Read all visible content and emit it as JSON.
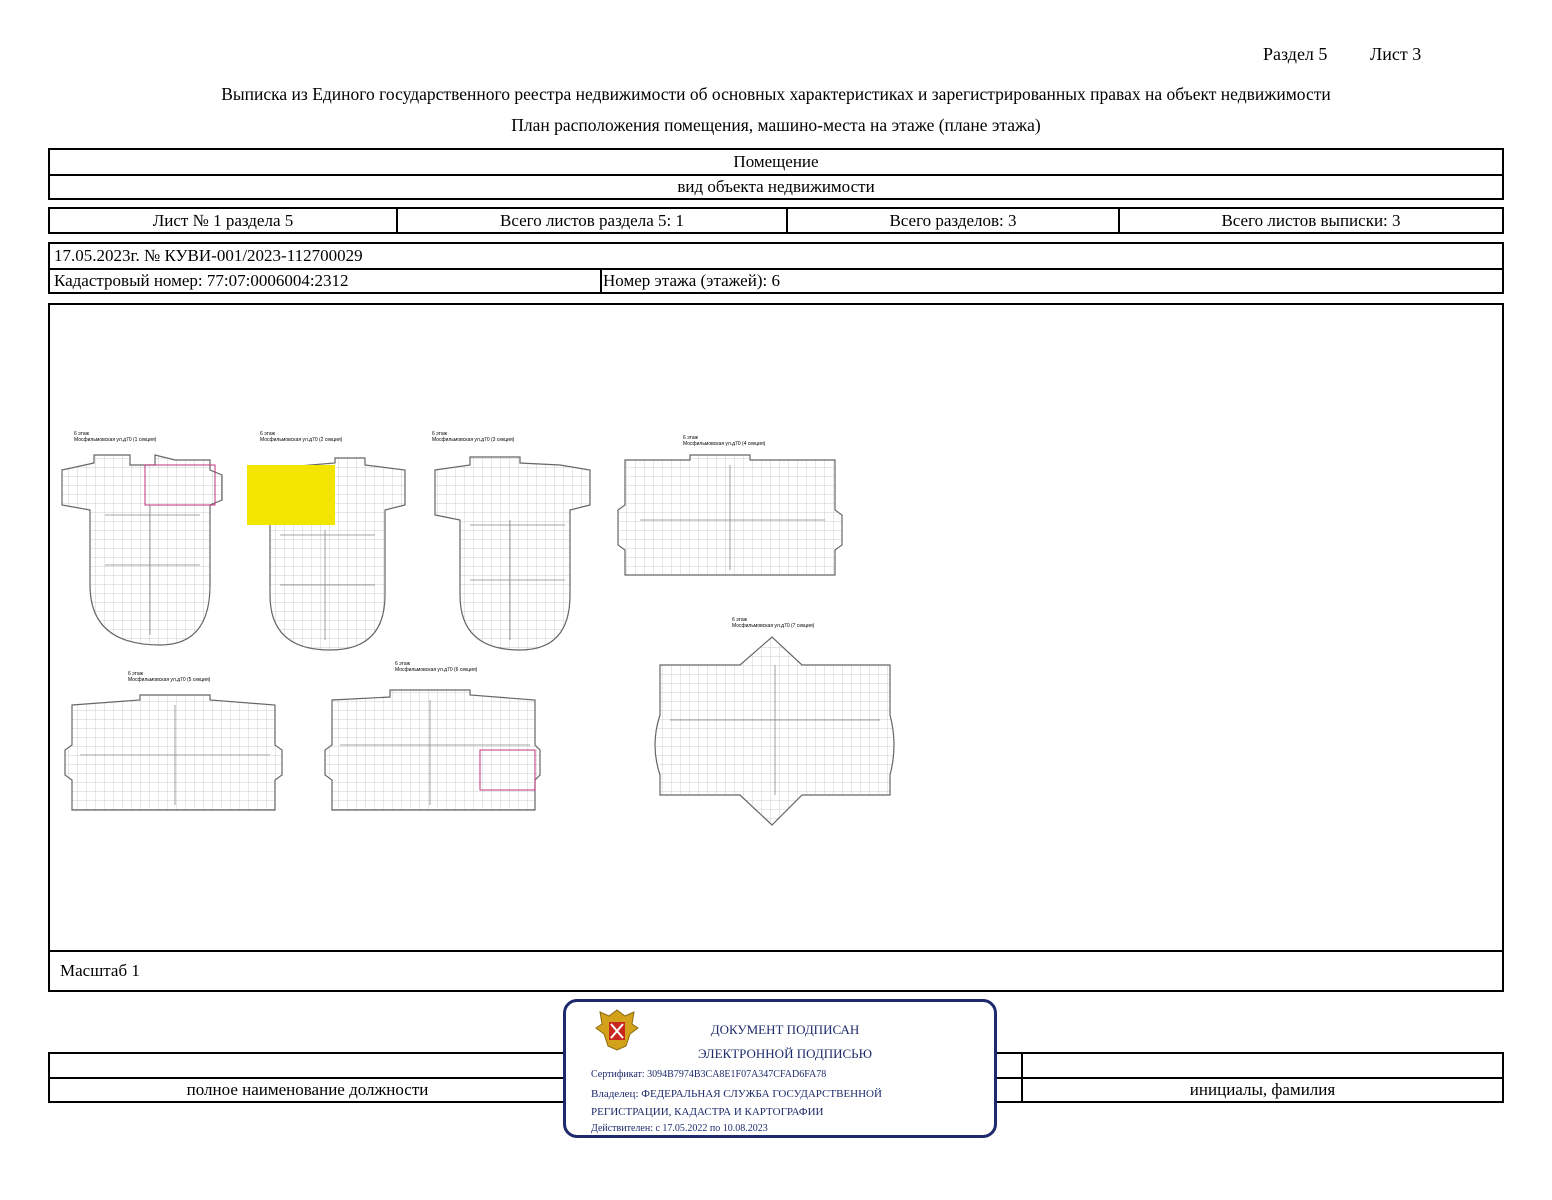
{
  "header": {
    "section": "Раздел 5",
    "sheet": "Лист 3",
    "title": "Выписка из Единого государственного реестра недвижимости об основных характеристиках и зарегистрированных правах на объект недвижимости",
    "subtitle": "План расположения помещения, машино-места на этаже (плане этажа)"
  },
  "object": {
    "type": "Помещение",
    "type_caption": "вид объекта недвижимости"
  },
  "sheets": {
    "sheet_no": "Лист № 1 раздела 5",
    "total_section_sheets": "Всего листов раздела 5: 1",
    "total_sections": "Всего разделов: 3",
    "total_extract_sheets": "Всего листов выписки: 3"
  },
  "record": {
    "date_number": "17.05.2023г. № КУВИ-001/2023-112700029",
    "cadastral": "Кадастровый номер: 77:07:0006004:2312",
    "floor": "Номер этажа (этажей): 6"
  },
  "plans": [
    {
      "floor": "6 этаж",
      "address": "Мосфильмовская ул.д70 (1 секция)"
    },
    {
      "floor": "6 этаж",
      "address": "Мосфильмовская ул.д70 (2 секция)"
    },
    {
      "floor": "6 этаж",
      "address": "Мосфильмовская ул.д70 (3 секция)"
    },
    {
      "floor": "6 этаж",
      "address": "Мосфильмовская ул.д70 (4 секция)"
    },
    {
      "floor": "6 этаж",
      "address": "Мосфильмовская ул.д70 (5 секция)"
    },
    {
      "floor": "6 этаж",
      "address": "Мосфильмовская ул.д70 (6 секция)"
    },
    {
      "floor": "6 этаж",
      "address": "Мосфильмовская ул.д70 (7 секция)"
    }
  ],
  "scale": "Масштаб 1",
  "footer": {
    "position_caption": "полное наименование должности",
    "name_caption": "инициалы, фамилия"
  },
  "stamp": {
    "line1": "ДОКУМЕНТ ПОДПИСАН",
    "line2": "ЭЛЕКТРОННОЙ ПОДПИСЬЮ",
    "certificate": "Сертификат: 3094B7974B3CA8E1F07A347CFAD6FA78",
    "owner1": "Владелец: ФЕДЕРАЛЬНАЯ СЛУЖБА ГОСУДАРСТВЕННОЙ",
    "owner2": "РЕГИСТРАЦИИ, КАДАСТРА И КАРТОГРАФИИ",
    "valid": "Действителен: с 17.05.2022 по 10.08.2023"
  },
  "colors": {
    "highlight": "#f2e600",
    "stamp_border": "#1d2a6b",
    "plan_accent": "#c0307a"
  }
}
